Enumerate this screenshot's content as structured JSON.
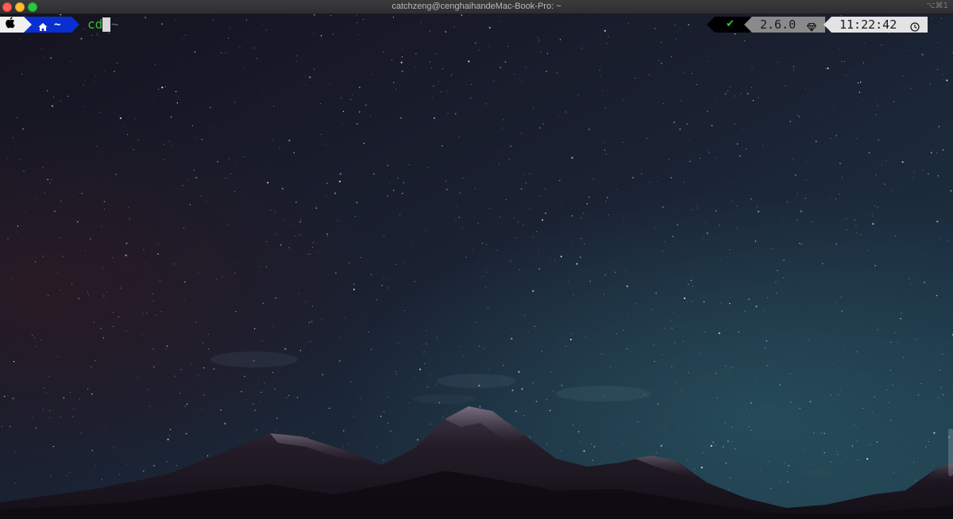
{
  "window": {
    "title": "catchzeng@cenghaihandeMac-Book-Pro: ~",
    "shortcut": "⌥⌘1"
  },
  "prompt": {
    "os_icon": "apple-logo-icon",
    "dir_icon": "home-icon",
    "dir": "~",
    "command": "cd",
    "autosuggestion": "~"
  },
  "right_prompt": {
    "status_icon": "check-icon",
    "status_symbol": "✔",
    "version": "2.6.0",
    "version_icon": "ruby-gem-icon",
    "time": "11:22:42",
    "time_icon": "clock-icon"
  },
  "colors": {
    "dir_segment": "#0a2fd0",
    "command_green": "#34c234",
    "check_green": "#32c832",
    "version_segment": "#8a8a8a",
    "time_segment": "#e3e3e3"
  },
  "background": {
    "description": "starry night sky over mountains"
  }
}
